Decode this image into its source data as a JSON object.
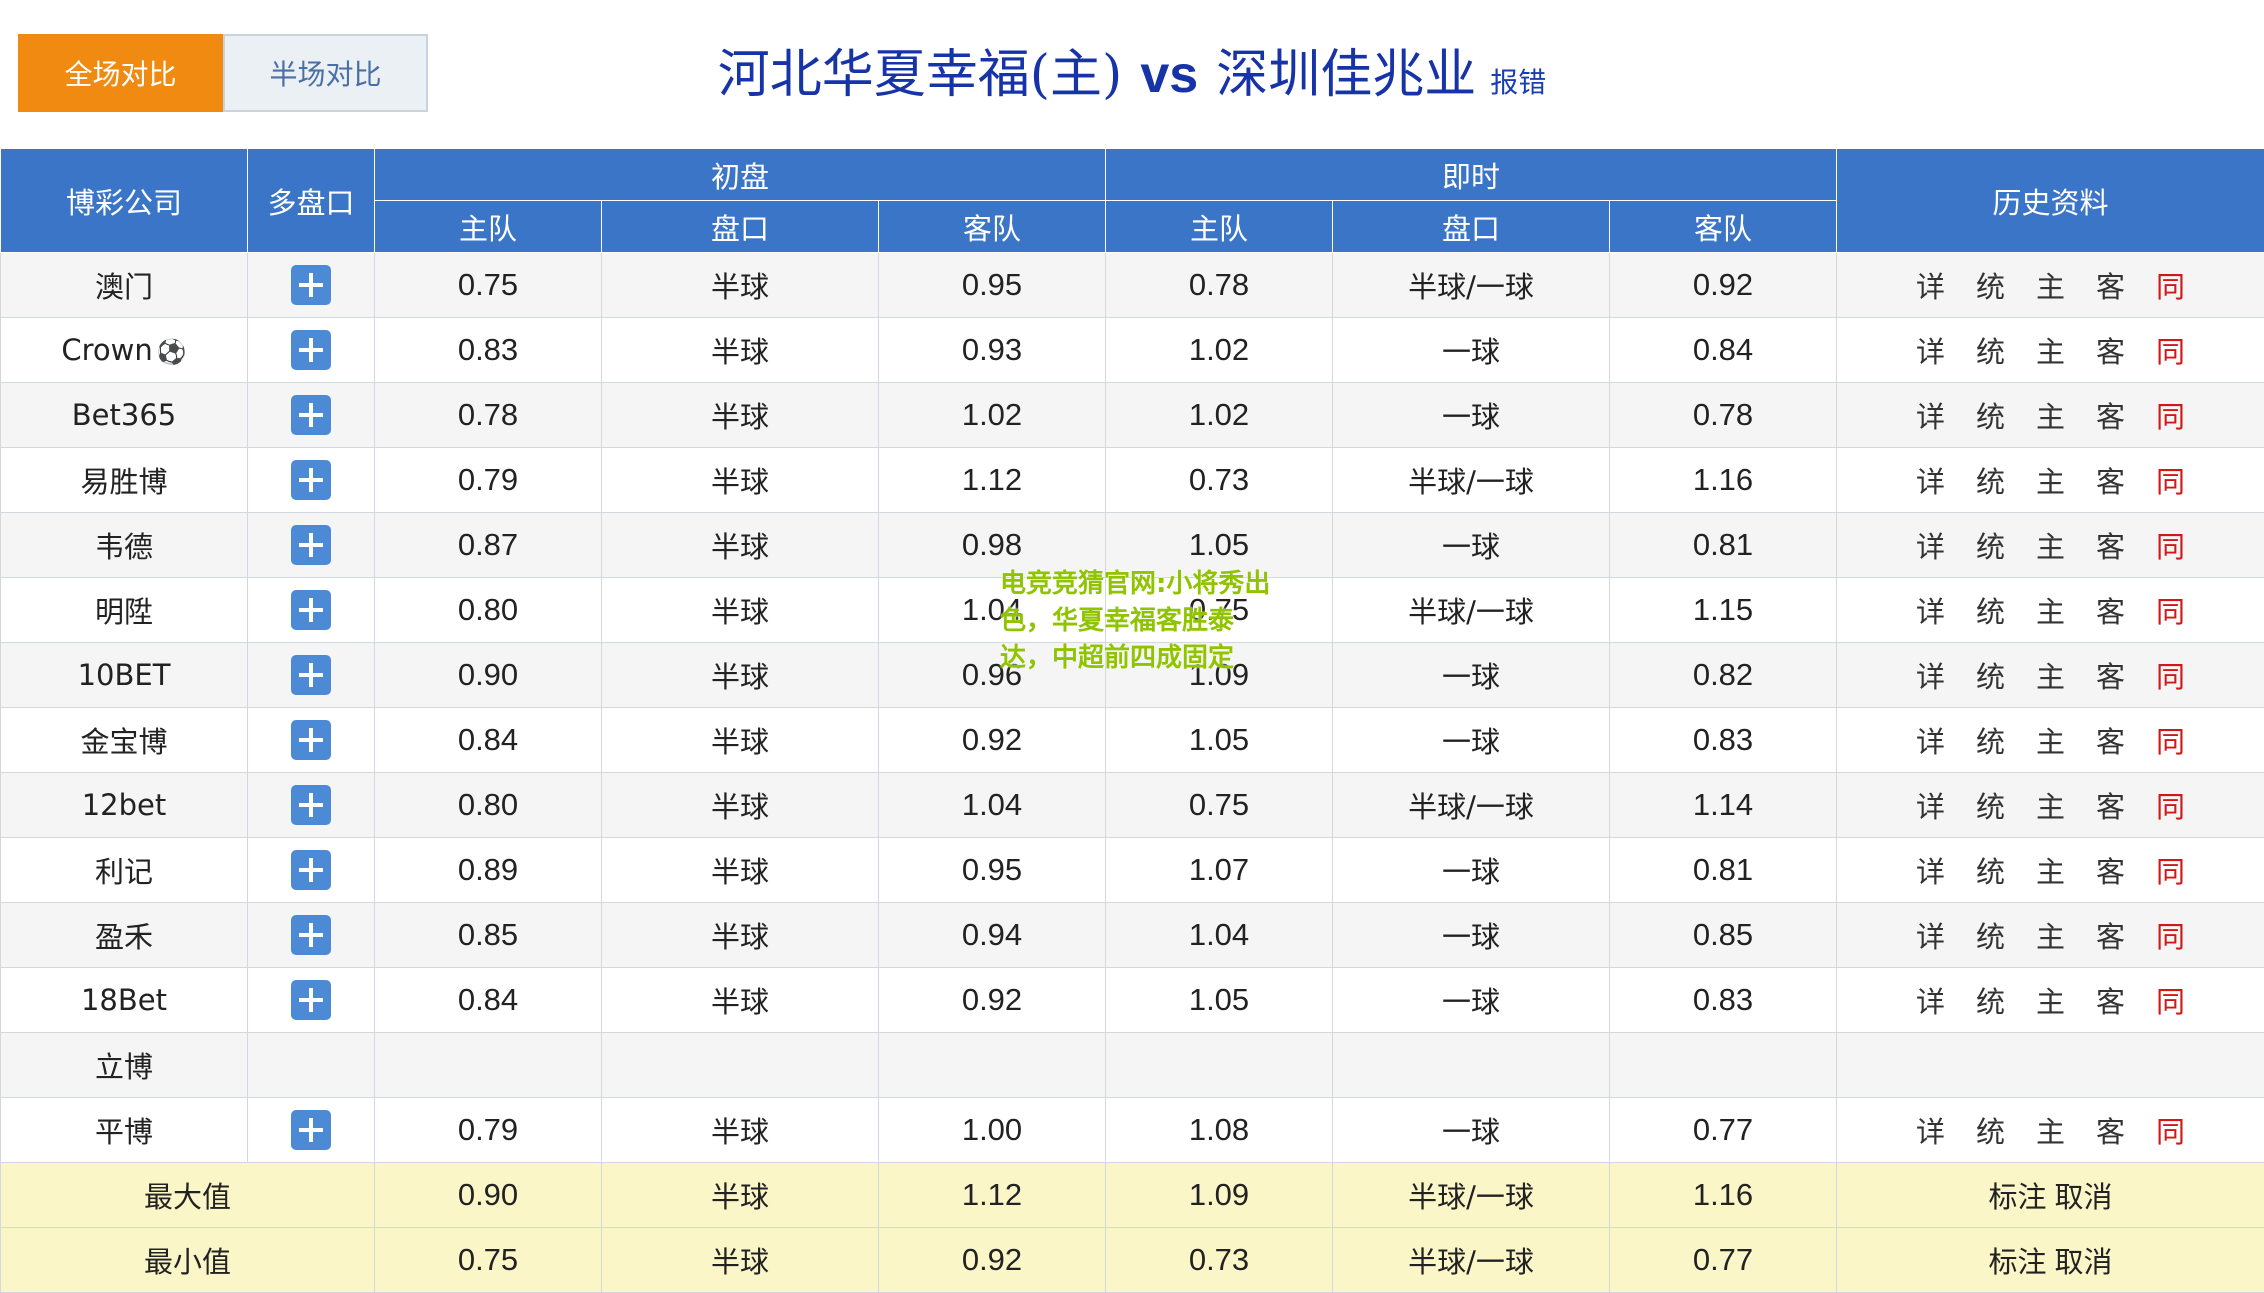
{
  "tabs": {
    "full": "全场对比",
    "half": "半场对比"
  },
  "match": {
    "home": "河北华夏幸福(主)",
    "vs": "vs",
    "away": "深圳佳兆业",
    "report": "报错"
  },
  "headers": {
    "company": "博彩公司",
    "multi": "多盘口",
    "initial": "初盘",
    "live": "即时",
    "history": "历史资料",
    "home": "主队",
    "line": "盘口",
    "away": "客队"
  },
  "icons": {
    "plus": "plus-square-icon",
    "ball": "soccer-ball-icon"
  },
  "colors": {
    "header_bg": "#3b75c8",
    "active_tab": "#f08a10",
    "summary_bg": "#fbf6c8",
    "same_link": "#d01818",
    "watermark": "#90c400"
  },
  "history_links": [
    "详",
    "统",
    "主",
    "客",
    "同"
  ],
  "rows": [
    {
      "company": "澳门",
      "init": [
        "0.75",
        "半球",
        "0.95"
      ],
      "live": [
        "0.78",
        "半球/一球",
        "0.92"
      ]
    },
    {
      "company": "Crown",
      "ball": "⚽",
      "init": [
        "0.83",
        "半球",
        "0.93"
      ],
      "live": [
        "1.02",
        "一球",
        "0.84"
      ]
    },
    {
      "company": "Bet365",
      "init": [
        "0.78",
        "半球",
        "1.02"
      ],
      "live": [
        "1.02",
        "一球",
        "0.78"
      ]
    },
    {
      "company": "易胜博",
      "init": [
        "0.79",
        "半球",
        "1.12"
      ],
      "live": [
        "0.73",
        "半球/一球",
        "1.16"
      ]
    },
    {
      "company": "韦德",
      "init": [
        "0.87",
        "半球",
        "0.98"
      ],
      "live": [
        "1.05",
        "一球",
        "0.81"
      ]
    },
    {
      "company": "明陞",
      "init": [
        "0.80",
        "半球",
        "1.04"
      ],
      "live": [
        "0.75",
        "半球/一球",
        "1.15"
      ]
    },
    {
      "company": "10BET",
      "init": [
        "0.90",
        "半球",
        "0.96"
      ],
      "live": [
        "1.09",
        "一球",
        "0.82"
      ]
    },
    {
      "company": "金宝博",
      "init": [
        "0.84",
        "半球",
        "0.92"
      ],
      "live": [
        "1.05",
        "一球",
        "0.83"
      ]
    },
    {
      "company": "12bet",
      "init": [
        "0.80",
        "半球",
        "1.04"
      ],
      "live": [
        "0.75",
        "半球/一球",
        "1.14"
      ]
    },
    {
      "company": "利记",
      "init": [
        "0.89",
        "半球",
        "0.95"
      ],
      "live": [
        "1.07",
        "一球",
        "0.81"
      ]
    },
    {
      "company": "盈禾",
      "init": [
        "0.85",
        "半球",
        "0.94"
      ],
      "live": [
        "1.04",
        "一球",
        "0.85"
      ]
    },
    {
      "company": "18Bet",
      "init": [
        "0.84",
        "半球",
        "0.92"
      ],
      "live": [
        "1.05",
        "一球",
        "0.83"
      ]
    },
    {
      "company": "立博",
      "empty": true
    },
    {
      "company": "平博",
      "init": [
        "0.79",
        "半球",
        "1.00"
      ],
      "live": [
        "1.08",
        "一球",
        "0.77"
      ]
    }
  ],
  "summary": [
    {
      "label": "最大值",
      "init": [
        "0.90",
        "半球",
        "1.12"
      ],
      "live": [
        "1.09",
        "半球/一球",
        "1.16"
      ],
      "mark": "标注",
      "cancel": "取消"
    },
    {
      "label": "最小值",
      "init": [
        "0.75",
        "半球",
        "0.92"
      ],
      "live": [
        "0.73",
        "半球/一球",
        "0.77"
      ],
      "mark": "标注",
      "cancel": "取消"
    }
  ],
  "watermark": "电竞竞猜官网:小将秀出色，华夏幸福客胜泰达，中超前四成固定"
}
